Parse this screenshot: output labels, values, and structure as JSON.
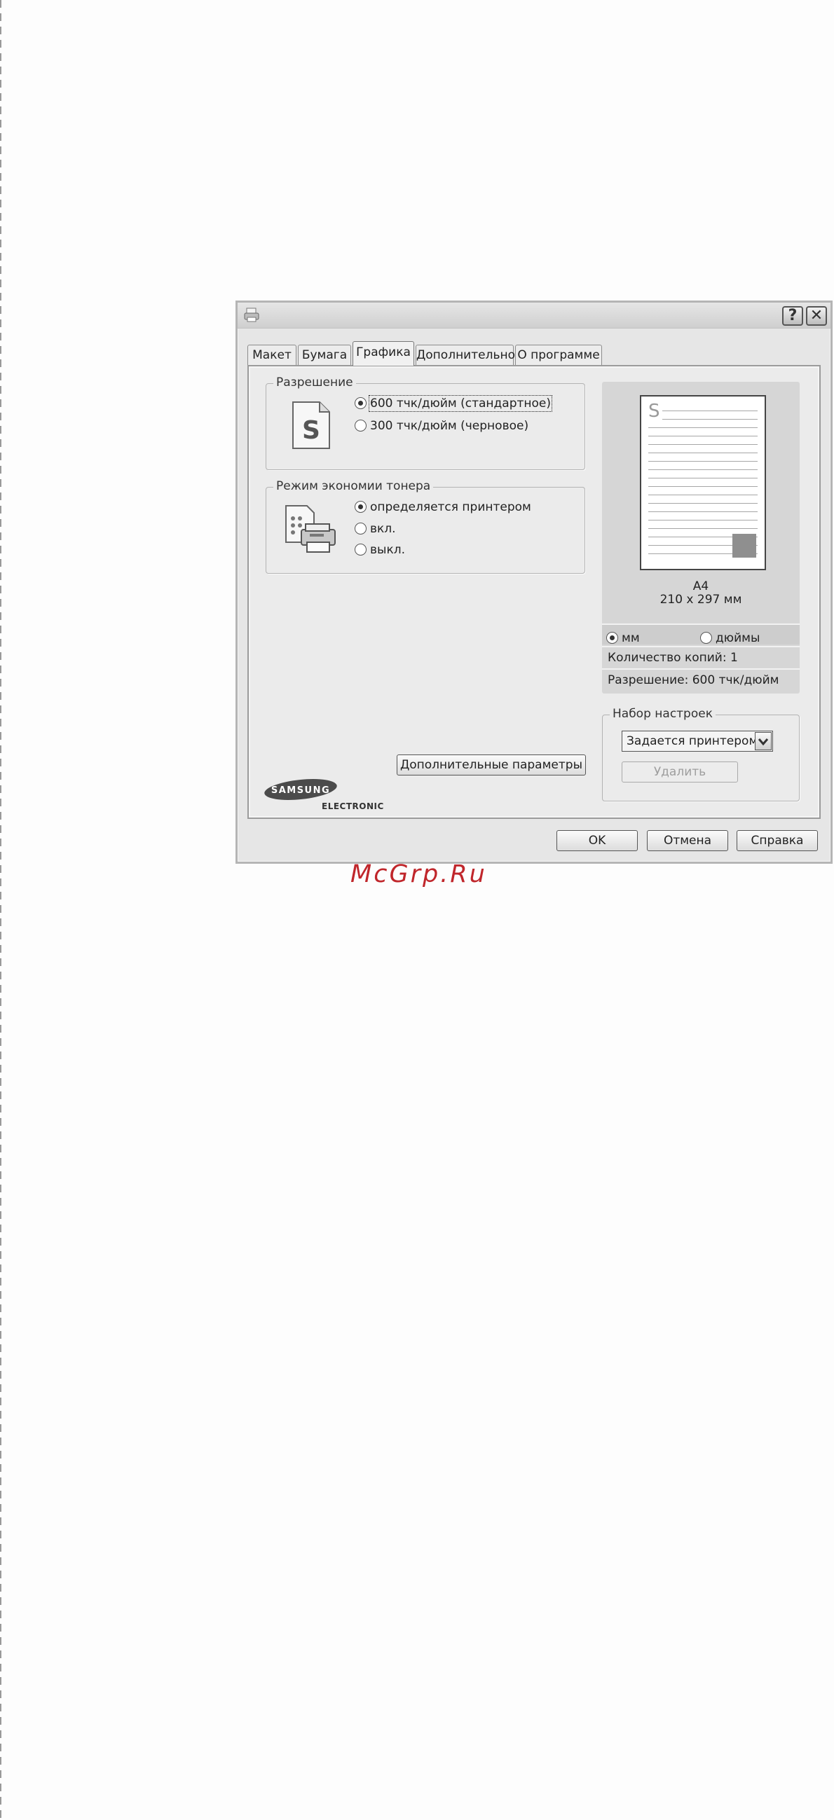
{
  "watermark": "McGrp.Ru",
  "titlebar": {
    "help": "?",
    "close": "✕"
  },
  "tabs": [
    {
      "label": "Макет",
      "active": false
    },
    {
      "label": "Бумага",
      "active": false
    },
    {
      "label": "Графика",
      "active": true
    },
    {
      "label": "Дополнительно",
      "active": false
    },
    {
      "label": "О программе",
      "active": false
    }
  ],
  "resolution": {
    "title": "Разрешение",
    "icon_letter": "S",
    "options": [
      {
        "label": "600 тчк/дюйм (стандартное)",
        "selected": true
      },
      {
        "label": "300 тчк/дюйм (черновое)",
        "selected": false
      }
    ]
  },
  "toner": {
    "title": "Режим экономии тонера",
    "options": [
      {
        "label": "определяется принтером",
        "selected": true
      },
      {
        "label": "вкл.",
        "selected": false
      },
      {
        "label": "выкл.",
        "selected": false
      }
    ]
  },
  "advanced_button": "Дополнительные параметры",
  "brand": {
    "logo_word": "SAMSUNG",
    "sub": "ELECTRONICS"
  },
  "preview": {
    "paper_letter": "S",
    "paper_name": "A4",
    "paper_size": "210 x 297 мм",
    "units": [
      {
        "label": "мм",
        "selected": true
      },
      {
        "label": "дюймы",
        "selected": false
      }
    ],
    "copies": "Количество копий: 1",
    "resolution": "Разрешение: 600 тчк/дюйм"
  },
  "presets": {
    "title": "Набор настроек",
    "selected": "Задается принтером",
    "delete": "Удалить"
  },
  "footer": {
    "ok": "OK",
    "cancel": "Отмена",
    "help": "Справка"
  }
}
